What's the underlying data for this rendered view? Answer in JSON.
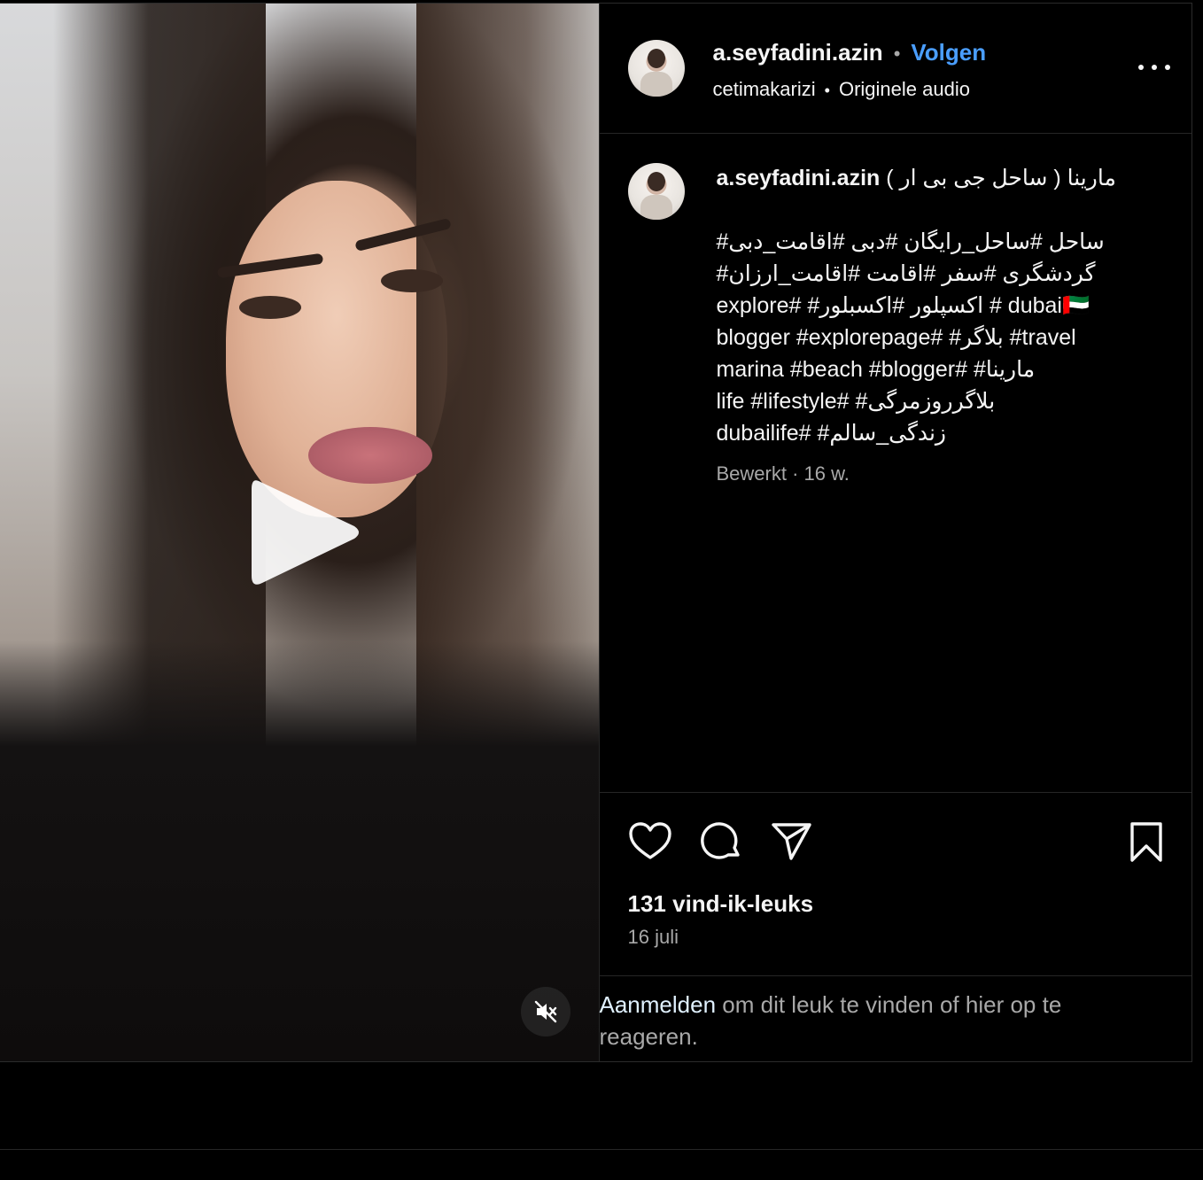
{
  "header": {
    "username": "a.seyfadini.azin",
    "separator": "•",
    "follow_label": "Volgen",
    "audio_owner": "cetimakarizi",
    "audio_label": "Originele audio",
    "more_icon": "more-horizontal-icon"
  },
  "caption": {
    "username": "a.seyfadini.azin",
    "title": "مارینا ( ساحل جی بی ار )",
    "hashtags": "#ساحل #ساحل_رایگان #دبی #اقامت_دبی\n#گردشگری #سفر #اقامت #اقامت_ارزان\nexplore# #اکسپلور #اکسبلور # dubai🇦🇪\nblogger #explorepage# #بلاگر #travel\nmarina #beach #blogger# #مارینا\nlife #lifestyle# #بلاگرروزمرگی\ndubailife# #زندگی_سالم",
    "meta": "Bewerkt · 16 w."
  },
  "actions": {
    "like_icon": "heart-icon",
    "comment_icon": "comment-icon",
    "share_icon": "send-icon",
    "save_icon": "bookmark-icon"
  },
  "likes": "131 vind-ik-leuks",
  "date": "16 juli",
  "login": {
    "link": "Aanmelden",
    "text": " om dit leuk te vinden of hier op te reageren."
  },
  "media": {
    "play_icon": "play-icon",
    "mute_icon": "muted-speaker-icon"
  },
  "colors": {
    "background": "#000000",
    "link_blue": "#4a9eff",
    "muted_text": "#a8a8a8",
    "border": "#262626"
  }
}
